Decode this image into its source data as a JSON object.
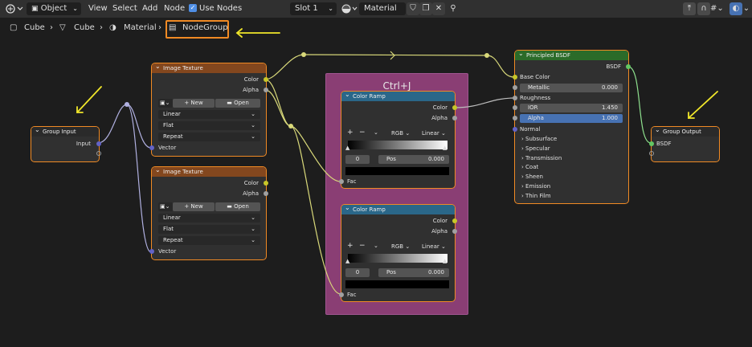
{
  "header": {
    "mode": "Object",
    "menu": [
      "View",
      "Select",
      "Add",
      "Node"
    ],
    "use_nodes_label": "Use Nodes",
    "slot": "Slot 1",
    "material": "Material"
  },
  "breadcrumb": {
    "items": [
      "Cube",
      "Cube",
      "Material",
      "NodeGroup"
    ]
  },
  "frame": {
    "label": "Ctrl+J"
  },
  "nodes": {
    "group_input": {
      "title": "Group Input",
      "outputs": [
        "Input"
      ]
    },
    "image_texture_1": {
      "title": "Image Texture",
      "outputs": [
        "Color",
        "Alpha"
      ],
      "new_label": "New",
      "open_label": "Open",
      "interpolation": "Linear",
      "projection": "Flat",
      "extension": "Repeat",
      "input": "Vector"
    },
    "image_texture_2": {
      "title": "Image Texture",
      "outputs": [
        "Color",
        "Alpha"
      ],
      "new_label": "New",
      "open_label": "Open",
      "interpolation": "Linear",
      "projection": "Flat",
      "extension": "Repeat",
      "input": "Vector"
    },
    "color_ramp_1": {
      "title": "Color Ramp",
      "outputs": [
        "Color",
        "Alpha"
      ],
      "color_mode": "RGB",
      "interpolation": "Linear",
      "index": "0",
      "pos_label": "Pos",
      "pos_value": "0.000",
      "input": "Fac"
    },
    "color_ramp_2": {
      "title": "Color Ramp",
      "outputs": [
        "Color",
        "Alpha"
      ],
      "color_mode": "RGB",
      "interpolation": "Linear",
      "index": "0",
      "pos_label": "Pos",
      "pos_value": "0.000",
      "input": "Fac"
    },
    "principled": {
      "title": "Principled BSDF",
      "output": "BSDF",
      "base_color": "Base Color",
      "metallic_label": "Metallic",
      "metallic_value": "0.000",
      "roughness": "Roughness",
      "ior_label": "IOR",
      "ior_value": "1.450",
      "alpha_label": "Alpha",
      "alpha_value": "1.000",
      "normal": "Normal",
      "panels": [
        "Subsurface",
        "Specular",
        "Transmission",
        "Coat",
        "Sheen",
        "Emission",
        "Thin Film"
      ]
    },
    "group_output": {
      "title": "Group Output",
      "inputs": [
        "BSDF"
      ]
    }
  },
  "colors": {
    "arrow": "#f0e62a",
    "highlight": "#f08a24",
    "wire_color": "#d9d97a",
    "wire_vector": "#b0b0e0"
  }
}
